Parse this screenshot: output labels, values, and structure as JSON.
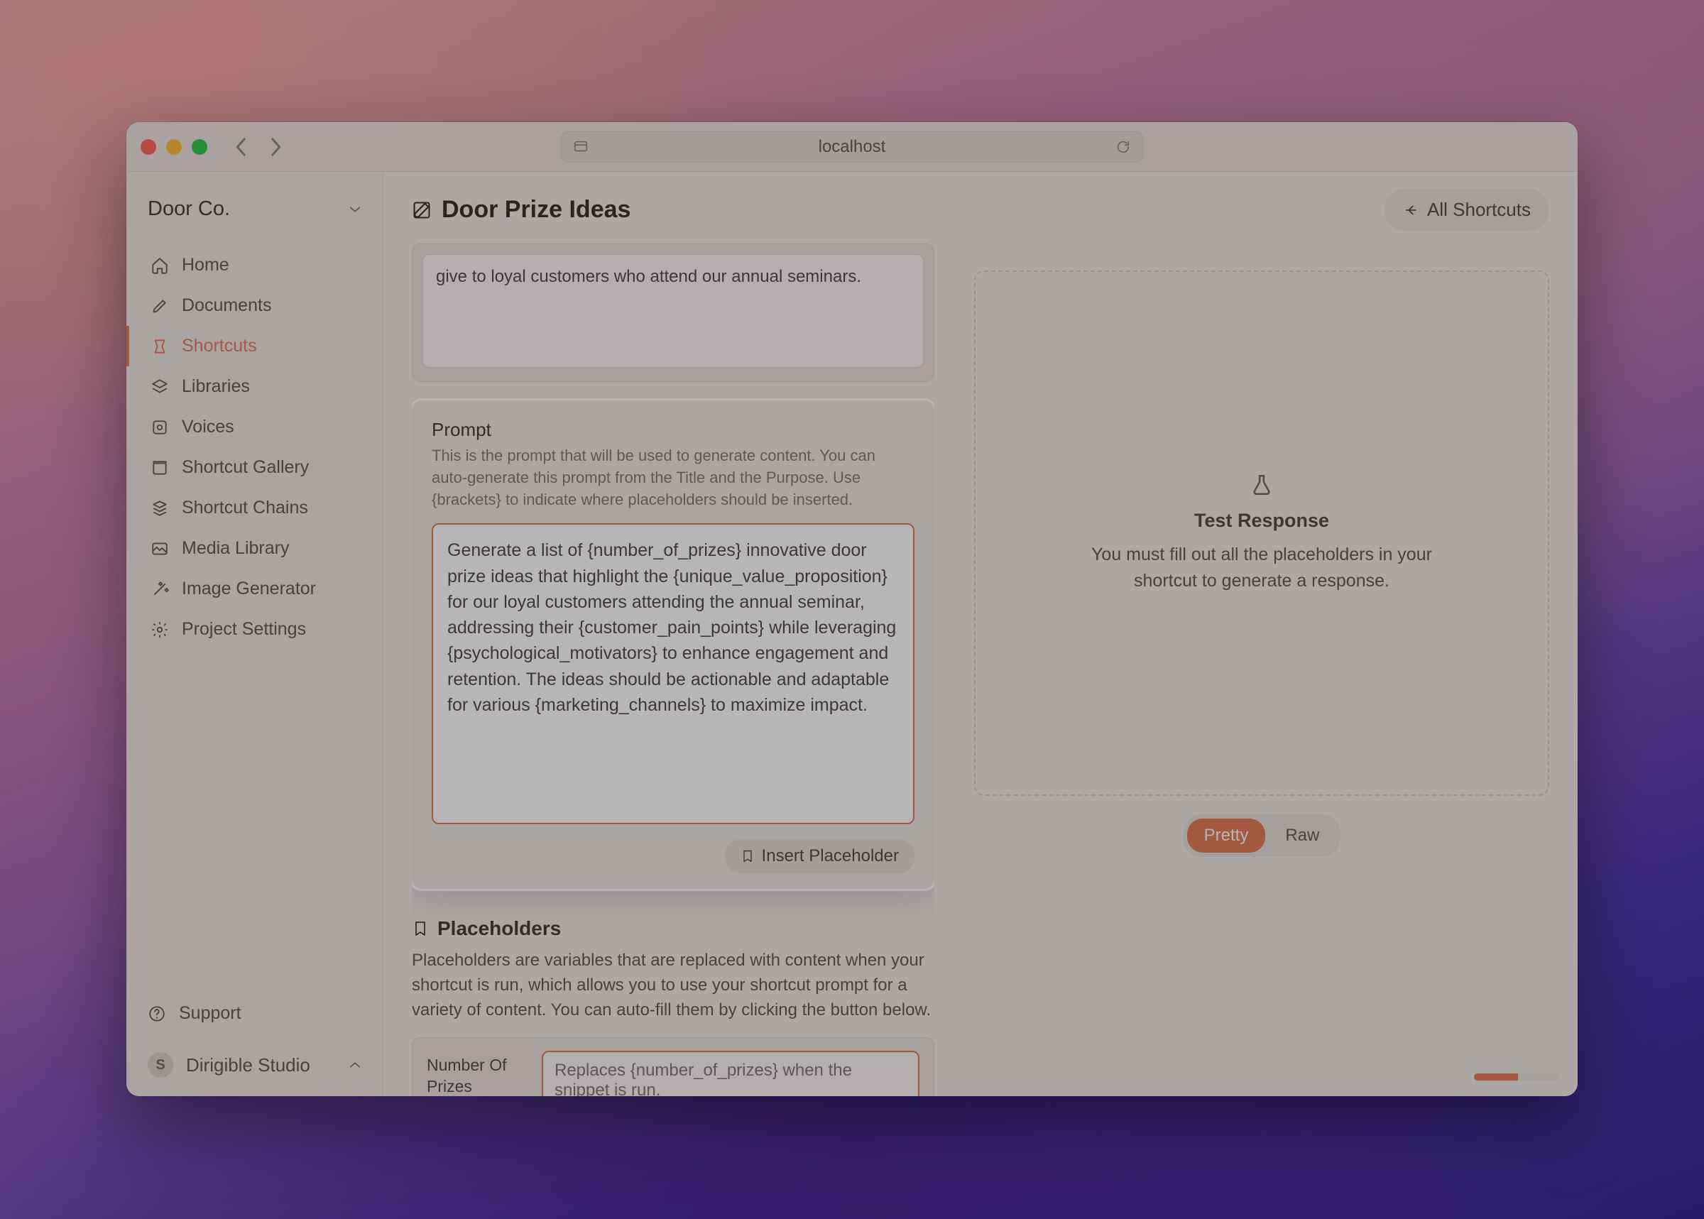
{
  "browser": {
    "url": "localhost"
  },
  "workspace": {
    "name": "Door Co."
  },
  "sidebar": {
    "items": [
      {
        "label": "Home"
      },
      {
        "label": "Documents"
      },
      {
        "label": "Shortcuts"
      },
      {
        "label": "Libraries"
      },
      {
        "label": "Voices"
      },
      {
        "label": "Shortcut Gallery"
      },
      {
        "label": "Shortcut Chains"
      },
      {
        "label": "Media Library"
      },
      {
        "label": "Image Generator"
      },
      {
        "label": "Project Settings"
      }
    ],
    "support_label": "Support",
    "studio_initial": "S",
    "studio_name": "Dirigible Studio"
  },
  "header": {
    "page_title": "Door Prize Ideas",
    "all_shortcuts_label": "All Shortcuts"
  },
  "purpose": {
    "value": "give to loyal customers who attend our annual seminars."
  },
  "prompt": {
    "section_title": "Prompt",
    "help": "This is the prompt that will be used to generate content. You can auto-generate this prompt from the Title and the Purpose. Use {brackets} to indicate where placeholders should be inserted.",
    "value": "Generate a list of {number_of_prizes} innovative door prize ideas that highlight the {unique_value_proposition} for our loyal customers attending the annual seminar, addressing their {customer_pain_points} while leveraging {psychological_motivators} to enhance engagement and retention. The ideas should be actionable and adaptable for various {marketing_channels} to maximize impact.",
    "insert_label": "Insert Placeholder"
  },
  "placeholders": {
    "section_title": "Placeholders",
    "description": "Placeholders are variables that are replaced with content when your shortcut is run, which allows you to use your shortcut prompt for a variety of content. You can auto-fill them by clicking the button below.",
    "fields": [
      {
        "label": "Number Of Prizes",
        "placeholder": "Replaces {number_of_prizes} when the snippet is run."
      }
    ]
  },
  "test": {
    "title": "Test Response",
    "message": "You must fill out all the placeholders in your shortcut to generate a response."
  },
  "toggle": {
    "pretty": "Pretty",
    "raw": "Raw"
  }
}
